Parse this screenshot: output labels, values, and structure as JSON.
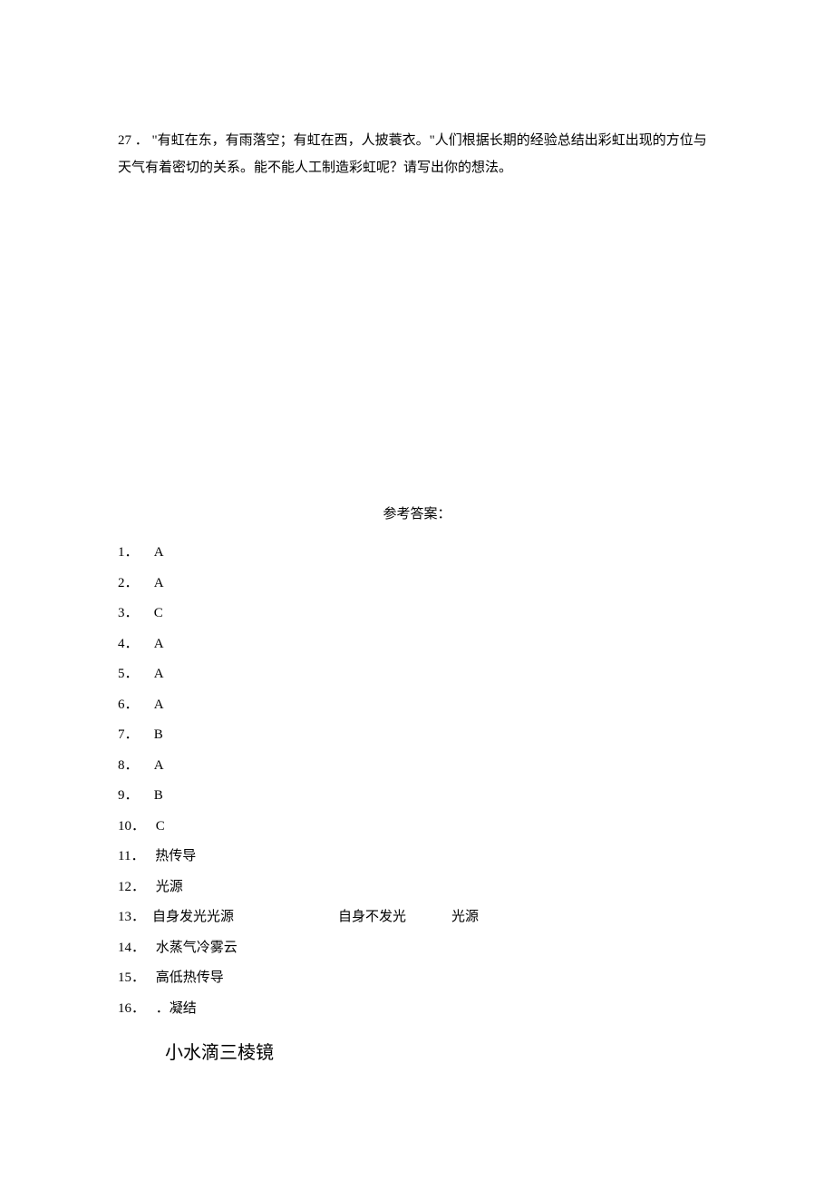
{
  "question": {
    "number": "27 ．",
    "text": "\"有虹在东，有雨落空；有虹在西，人披蓑衣。\"人们根据长期的经验总结出彩虹出现的方位与天气有着密切的关系。能不能人工制造彩虹呢？请写出你的想法。"
  },
  "answerHeader": "参考答案：",
  "answers": {
    "a1": {
      "num": "1．",
      "val": "A"
    },
    "a2": {
      "num": "2．",
      "val": "A"
    },
    "a3": {
      "num": "3．",
      "val": "C"
    },
    "a4": {
      "num": "4．",
      "val": "A"
    },
    "a5": {
      "num": "5．",
      "val": "A"
    },
    "a6": {
      "num": "6．",
      "val": "A"
    },
    "a7": {
      "num": "7．",
      "val": "B"
    },
    "a8": {
      "num": "8．",
      "val": "A"
    },
    "a9": {
      "num": "9．",
      "val": "B"
    },
    "a10": {
      "num": "10．",
      "val": "C"
    },
    "a11": {
      "num": "11．",
      "val": "热传导"
    },
    "a12": {
      "num": "12．",
      "val": "光源"
    },
    "a13": {
      "num": "13．",
      "part1": "自身发光光源",
      "part2": "自身不发光",
      "part3": "光源"
    },
    "a14": {
      "num": "14．",
      "val": "水蒸气冷雾云"
    },
    "a15": {
      "num": "15．",
      "val": "高低热传导"
    },
    "a16": {
      "num": "16．",
      "val": "．凝结"
    }
  },
  "bigText": "小水滴三棱镜"
}
